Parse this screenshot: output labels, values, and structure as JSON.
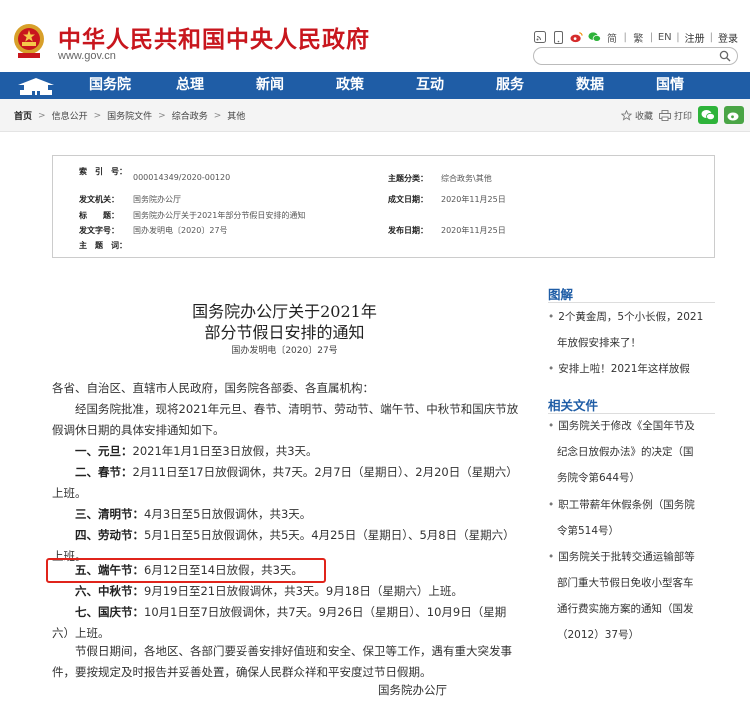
{
  "header": {
    "site_title": "中华人民共和国中央人民政府",
    "site_url": "www.gov.cn",
    "links": [
      "简",
      "繁",
      "EN",
      "注册",
      "登录"
    ],
    "search_placeholder": ""
  },
  "nav": {
    "items": [
      "国务院",
      "总理",
      "新闻",
      "政策",
      "互动",
      "服务",
      "数据",
      "国情"
    ]
  },
  "breadcrumb": {
    "items": [
      "首页",
      "信息公开",
      "国务院文件",
      "综合政务",
      "其他"
    ]
  },
  "share": {
    "favorite": "收藏",
    "print": "打印"
  },
  "meta": {
    "index_label": "索　引　号：",
    "index_value": "000014349/2020-00120",
    "topic_label": "主题分类：",
    "topic_value": "综合政务\\其他",
    "issuer_label": "发文机关：",
    "issuer_value": "国务院办公厅",
    "date_label": "成文日期：",
    "date_value": "2020年11月25日",
    "title_label": "标　　题：",
    "title_value": "国务院办公厅关于2021年部分节假日安排的通知",
    "doc_label": "发文字号：",
    "doc_value": "国办发明电〔2020〕27号",
    "publish_label": "发布日期：",
    "publish_value": "2020年11月25日",
    "keyword_label": "主　题　词："
  },
  "article": {
    "title_line1": "国务院办公厅关于2021年",
    "title_line2": "部分节假日安排的通知",
    "doc_number": "国办发明电〔2020〕27号",
    "salutation": "各省、自治区、直辖市人民政府，国务院各部委、各直属机构：",
    "intro_line1": "经国务院批准，现将2021年元旦、春节、清明节、劳动节、端午节、中秋节和国庆节放",
    "intro_line2": "假调休日期的具体安排通知如下。",
    "h1_name": "一、元旦：",
    "h1_text": "2021年1月1日至3日放假，共3天。",
    "h2_name": "二、春节：",
    "h2_text": "2月11日至17日放假调休，共7天。2月7日（星期日）、2月20日（星期六）",
    "h2_cont": "上班。",
    "h3_name": "三、清明节：",
    "h3_text": "4月3日至5日放假调休，共3天。",
    "h4_name": "四、劳动节：",
    "h4_text": "5月1日至5日放假调休，共5天。4月25日（星期日）、5月8日（星期六）",
    "h4_cont": "上班。",
    "h5_name": "五、端午节：",
    "h5_text": "6月12日至14日放假，共3天。",
    "h6_name": "六、中秋节：",
    "h6_text": "9月19日至21日放假调休，共3天。9月18日（星期六）上班。",
    "h7_name": "七、国庆节：",
    "h7_text": "10月1日至7日放假调休，共7天。9月26日（星期日）、10月9日（星期",
    "h7_cont": "六）上班。",
    "closing_line1": "节假日期间，各地区、各部门要妥善安排好值班和安全、保卫等工作，遇有重大突发事",
    "closing_line2": "件，要按规定及时报告并妥善处置，确保人民群众祥和平安度过节日假期。",
    "signature": "国务院办公厅"
  },
  "sidebar": {
    "graphic_title": "图解",
    "graphic_items": [
      [
        "2个黄金周，5个小长假，2021",
        "年放假安排来了！"
      ],
      [
        "安排上啦！2021年这样放假"
      ]
    ],
    "related_title": "相关文件",
    "related_items": [
      [
        "国务院关于修改《全国年节及",
        "纪念日放假办法》的决定（国",
        "务院令第644号）"
      ],
      [
        "职工带薪年休假条例（国务院",
        "令第514号）"
      ],
      [
        "国务院关于批转交通运输部等",
        "部门重大节假日免收小型客车",
        "通行费实施方案的通知（国发",
        "（2012）37号）"
      ]
    ]
  },
  "colors": {
    "brand_red": "#c8161d",
    "nav_blue": "#1f5da6",
    "highlight_red": "#e0241b",
    "wechat_green": "#2eb33a",
    "weibo_green": "#4aa546"
  }
}
